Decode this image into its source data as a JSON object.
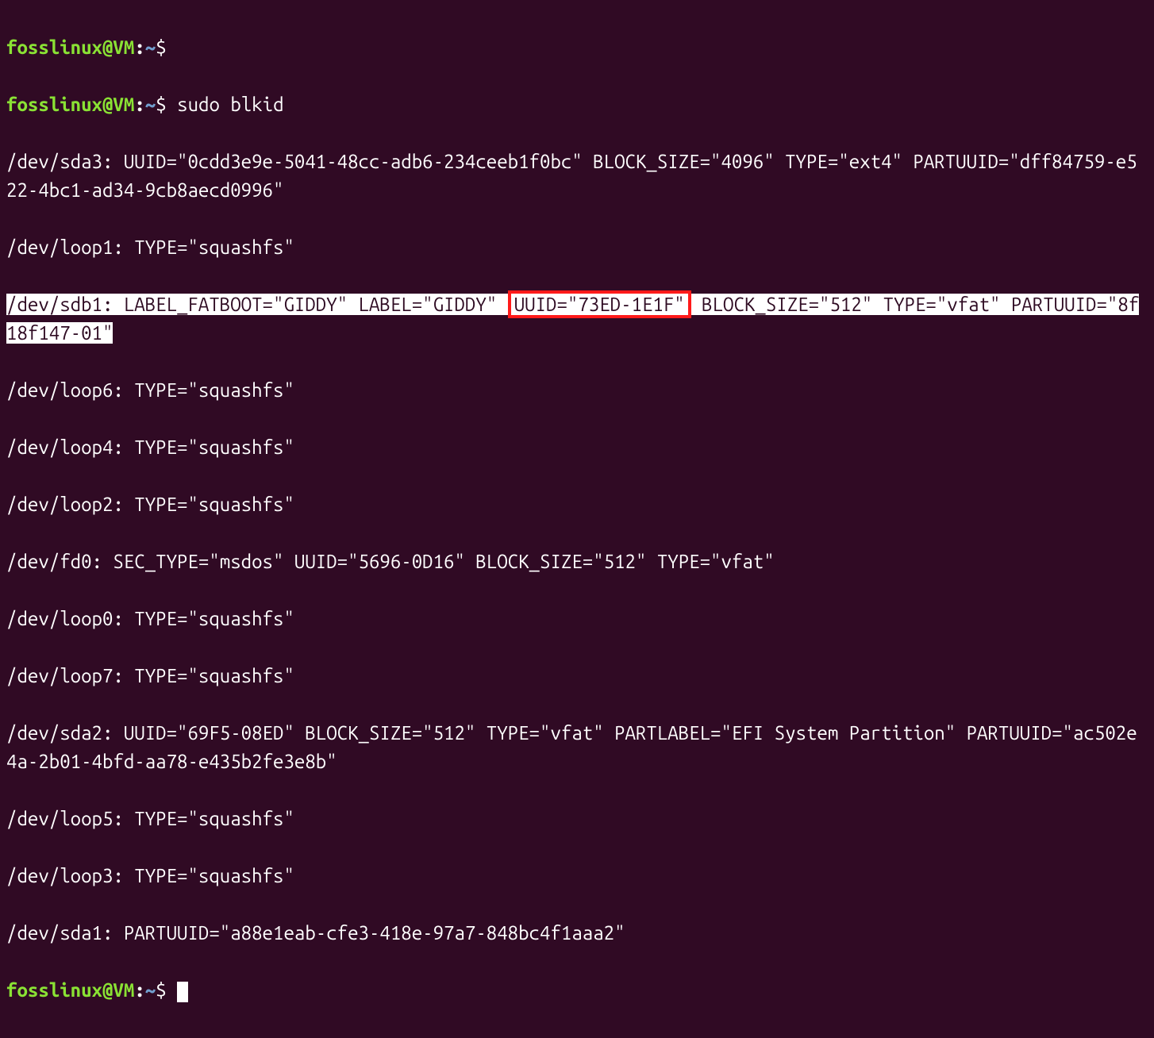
{
  "prompt": {
    "user": "fosslinux",
    "host": "VM",
    "path": "~",
    "symbol": "$"
  },
  "commands": {
    "cmd1": "",
    "cmd2": "sudo blkid"
  },
  "output": {
    "line1": "/dev/sda3: UUID=\"0cdd3e9e-5041-48cc-adb6-234ceeb1f0bc\" BLOCK_SIZE=\"4096\" TYPE=\"ext4\" PARTUUID=\"dff84759-e522-4bc1-ad34-9cb8aecd0996\"",
    "line2": "/dev/loop1: TYPE=\"squashfs\"",
    "hl_pre": "/dev/sdb1: LABEL_FATBOOT=\"GIDDY\" LABEL=\"GIDDY\" ",
    "hl_box": "UUID=\"73ED-1E1F\"",
    "hl_post": " BLOCK_SIZE=\"512\" TYPE=\"vfat\" PARTUUID=\"8f18f147-01\"",
    "line4": "/dev/loop6: TYPE=\"squashfs\"",
    "line5": "/dev/loop4: TYPE=\"squashfs\"",
    "line6": "/dev/loop2: TYPE=\"squashfs\"",
    "line7": "/dev/fd0: SEC_TYPE=\"msdos\" UUID=\"5696-0D16\" BLOCK_SIZE=\"512\" TYPE=\"vfat\"",
    "line8": "/dev/loop0: TYPE=\"squashfs\"",
    "line9": "/dev/loop7: TYPE=\"squashfs\"",
    "line10": "/dev/sda2: UUID=\"69F5-08ED\" BLOCK_SIZE=\"512\" TYPE=\"vfat\" PARTLABEL=\"EFI System Partition\" PARTUUID=\"ac502e4a-2b01-4bfd-aa78-e435b2fe3e8b\"",
    "line11": "/dev/loop5: TYPE=\"squashfs\"",
    "line12": "/dev/loop3: TYPE=\"squashfs\"",
    "line13": "/dev/sda1: PARTUUID=\"a88e1eab-cfe3-418e-97a7-848bc4f1aaa2\""
  }
}
